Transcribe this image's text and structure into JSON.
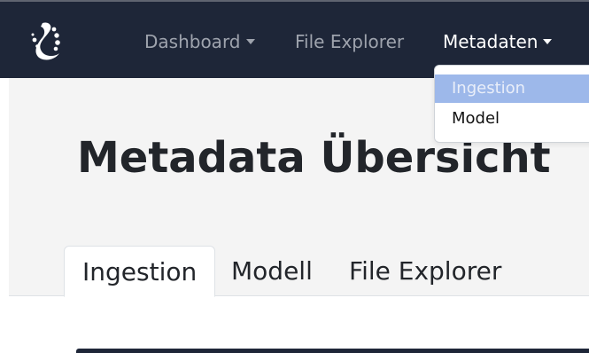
{
  "navbar": {
    "logo_icon": "octopus-tentacle-logo-icon",
    "items": [
      {
        "label": "Dashboard",
        "has_dropdown": true
      },
      {
        "label": "File Explorer",
        "has_dropdown": false
      },
      {
        "label": "Metadaten",
        "has_dropdown": true,
        "active": true
      }
    ]
  },
  "dropdown": {
    "items": [
      {
        "label": "Ingestion",
        "highlighted": true
      },
      {
        "label": "Model"
      }
    ]
  },
  "main": {
    "title": "Metadata Übersicht",
    "tabs": [
      {
        "label": "Ingestion",
        "active": true
      },
      {
        "label": "Modell"
      },
      {
        "label": "File Explorer"
      }
    ]
  },
  "colors": {
    "navbar_bg": "#1e2638",
    "nav_text": "#9ea3ad",
    "nav_text_active": "#ffffff",
    "jumbotron_bg": "#f4f4f4",
    "dropdown_highlight": "#9db8ea"
  }
}
